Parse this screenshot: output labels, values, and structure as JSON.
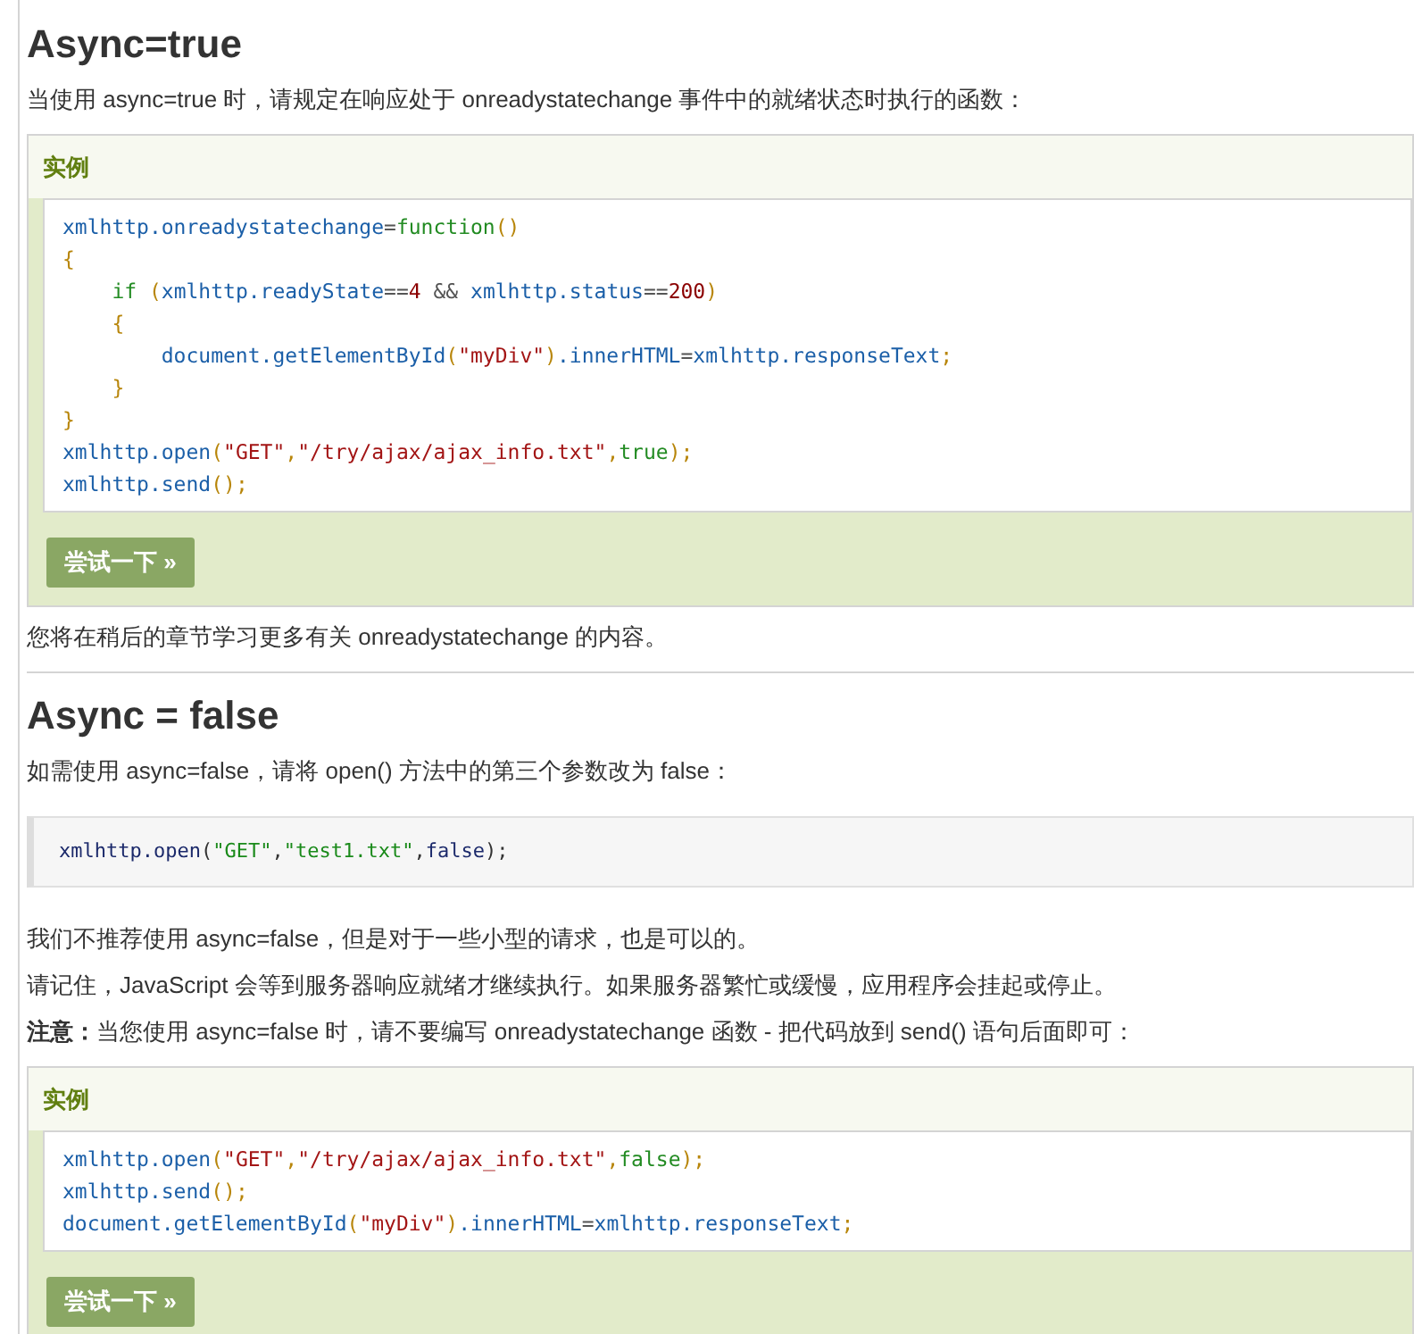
{
  "sections": [
    {
      "kind": "heading",
      "text": "Async=true"
    },
    {
      "kind": "para",
      "text": "当使用 async=true 时，请规定在响应处于 onreadystatechange 事件中的就绪状态时执行的函数："
    },
    {
      "kind": "example",
      "label": "实例",
      "button": "尝试一下 »",
      "lines": [
        [
          {
            "kind": "id",
            "t": "xmlhttp.onreadystatechange"
          },
          {
            "kind": "op",
            "t": "="
          },
          {
            "kind": "kw",
            "t": "function"
          },
          {
            "kind": "punc",
            "t": "()"
          }
        ],
        [
          {
            "kind": "punc",
            "t": "{"
          }
        ],
        [
          {
            "kind": "kw",
            "t": "    if "
          },
          {
            "kind": "punc",
            "t": "("
          },
          {
            "kind": "id",
            "t": "xmlhttp.readyState"
          },
          {
            "kind": "op",
            "t": "=="
          },
          {
            "kind": "num",
            "t": "4"
          },
          {
            "kind": "op",
            "t": " && "
          },
          {
            "kind": "id",
            "t": "xmlhttp.status"
          },
          {
            "kind": "op",
            "t": "=="
          },
          {
            "kind": "num",
            "t": "200"
          },
          {
            "kind": "punc",
            "t": ")"
          }
        ],
        [
          {
            "kind": "punc",
            "t": "    {"
          }
        ],
        [
          {
            "kind": "id",
            "t": "        document.getElementById"
          },
          {
            "kind": "punc",
            "t": "("
          },
          {
            "kind": "str",
            "t": "\"myDiv\""
          },
          {
            "kind": "punc",
            "t": ")"
          },
          {
            "kind": "id",
            "t": ".innerHTML"
          },
          {
            "kind": "op",
            "t": "="
          },
          {
            "kind": "id",
            "t": "xmlhttp.responseText"
          },
          {
            "kind": "punc",
            "t": ";"
          }
        ],
        [
          {
            "kind": "punc",
            "t": "    }"
          }
        ],
        [
          {
            "kind": "punc",
            "t": "}"
          }
        ],
        [
          {
            "kind": "id",
            "t": "xmlhttp.open"
          },
          {
            "kind": "punc",
            "t": "("
          },
          {
            "kind": "str",
            "t": "\"GET\""
          },
          {
            "kind": "punc",
            "t": ","
          },
          {
            "kind": "str",
            "t": "\"/try/ajax/ajax_info.txt\""
          },
          {
            "kind": "punc",
            "t": ","
          },
          {
            "kind": "kw",
            "t": "true"
          },
          {
            "kind": "punc",
            "t": ");"
          }
        ],
        [
          {
            "kind": "id",
            "t": "xmlhttp.send"
          },
          {
            "kind": "punc",
            "t": "();"
          }
        ]
      ]
    },
    {
      "kind": "para",
      "text": "您将在稍后的章节学习更多有关 onreadystatechange 的内容。"
    },
    {
      "kind": "rule"
    },
    {
      "kind": "heading",
      "text": "Async = false"
    },
    {
      "kind": "para",
      "text": "如需使用 async=false，请将 open() 方法中的第三个参数改为 false："
    },
    {
      "kind": "pre",
      "lines": [
        [
          {
            "kind": "id",
            "t": "xmlhttp.open"
          },
          {
            "kind": "punc",
            "t": "("
          },
          {
            "kind": "str2",
            "t": "\"GET\""
          },
          {
            "kind": "punc",
            "t": ","
          },
          {
            "kind": "str2",
            "t": "\"test1.txt\""
          },
          {
            "kind": "punc",
            "t": ","
          },
          {
            "kind": "id",
            "t": "false"
          },
          {
            "kind": "punc",
            "t": ");"
          }
        ]
      ]
    },
    {
      "kind": "para",
      "text": "我们不推荐使用 async=false，但是对于一些小型的请求，也是可以的。"
    },
    {
      "kind": "para",
      "text": "请记住，JavaScript 会等到服务器响应就绪才继续执行。如果服务器繁忙或缓慢，应用程序会挂起或停止。"
    },
    {
      "kind": "para",
      "text": "**注意：**当您使用 async=false 时，请不要编写 onreadystatechange 函数 - 把代码放到 send() 语句后面即可："
    },
    {
      "kind": "example",
      "label": "实例",
      "button": "尝试一下 »",
      "lines": [
        [
          {
            "kind": "id",
            "t": "xmlhttp.open"
          },
          {
            "kind": "punc",
            "t": "("
          },
          {
            "kind": "str",
            "t": "\"GET\""
          },
          {
            "kind": "punc",
            "t": ","
          },
          {
            "kind": "str",
            "t": "\"/try/ajax/ajax_info.txt\""
          },
          {
            "kind": "punc",
            "t": ","
          },
          {
            "kind": "kw",
            "t": "false"
          },
          {
            "kind": "punc",
            "t": ");"
          }
        ],
        [
          {
            "kind": "id",
            "t": "xmlhttp.send"
          },
          {
            "kind": "punc",
            "t": "();"
          }
        ],
        [
          {
            "kind": "id",
            "t": "document.getElementById"
          },
          {
            "kind": "punc",
            "t": "("
          },
          {
            "kind": "str",
            "t": "\"myDiv\""
          },
          {
            "kind": "punc",
            "t": ")"
          },
          {
            "kind": "id",
            "t": ".innerHTML"
          },
          {
            "kind": "op",
            "t": "="
          },
          {
            "kind": "id",
            "t": "xmlhttp.responseText"
          },
          {
            "kind": "punc",
            "t": ";"
          }
        ]
      ]
    }
  ]
}
